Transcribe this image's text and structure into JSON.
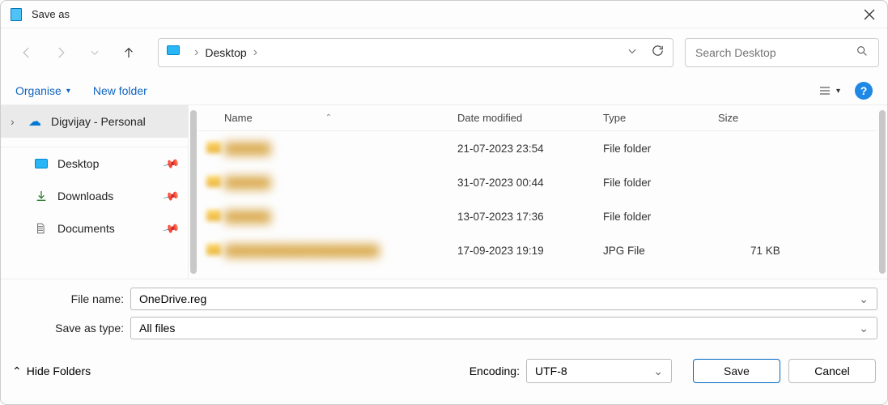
{
  "titlebar": {
    "title": "Save as"
  },
  "nav": {
    "refresh_name": "refresh-icon"
  },
  "address": {
    "location": "Desktop"
  },
  "search": {
    "placeholder": "Search Desktop"
  },
  "toolbar": {
    "organise": "Organise",
    "new_folder": "New folder"
  },
  "sidebar": {
    "personal": "Digvijay - Personal",
    "items": [
      {
        "label": "Desktop"
      },
      {
        "label": "Downloads"
      },
      {
        "label": "Documents"
      }
    ]
  },
  "columns": {
    "name": "Name",
    "date": "Date modified",
    "type": "Type",
    "size": "Size"
  },
  "files": [
    {
      "name": "██████",
      "date": "21-07-2023 23:54",
      "type": "File folder",
      "size": ""
    },
    {
      "name": "██████",
      "date": "31-07-2023 00:44",
      "type": "File folder",
      "size": ""
    },
    {
      "name": "██████",
      "date": "13-07-2023 17:36",
      "type": "File folder",
      "size": ""
    },
    {
      "name": "████████████████████",
      "date": "17-09-2023 19:19",
      "type": "JPG File",
      "size": "71 KB"
    }
  ],
  "form": {
    "filename_label": "File name:",
    "filename_value": "OneDrive.reg",
    "savetype_label": "Save as type:",
    "savetype_value": "All files"
  },
  "footer": {
    "hide_folders": "Hide Folders",
    "encoding_label": "Encoding:",
    "encoding_value": "UTF-8",
    "save": "Save",
    "cancel": "Cancel"
  }
}
